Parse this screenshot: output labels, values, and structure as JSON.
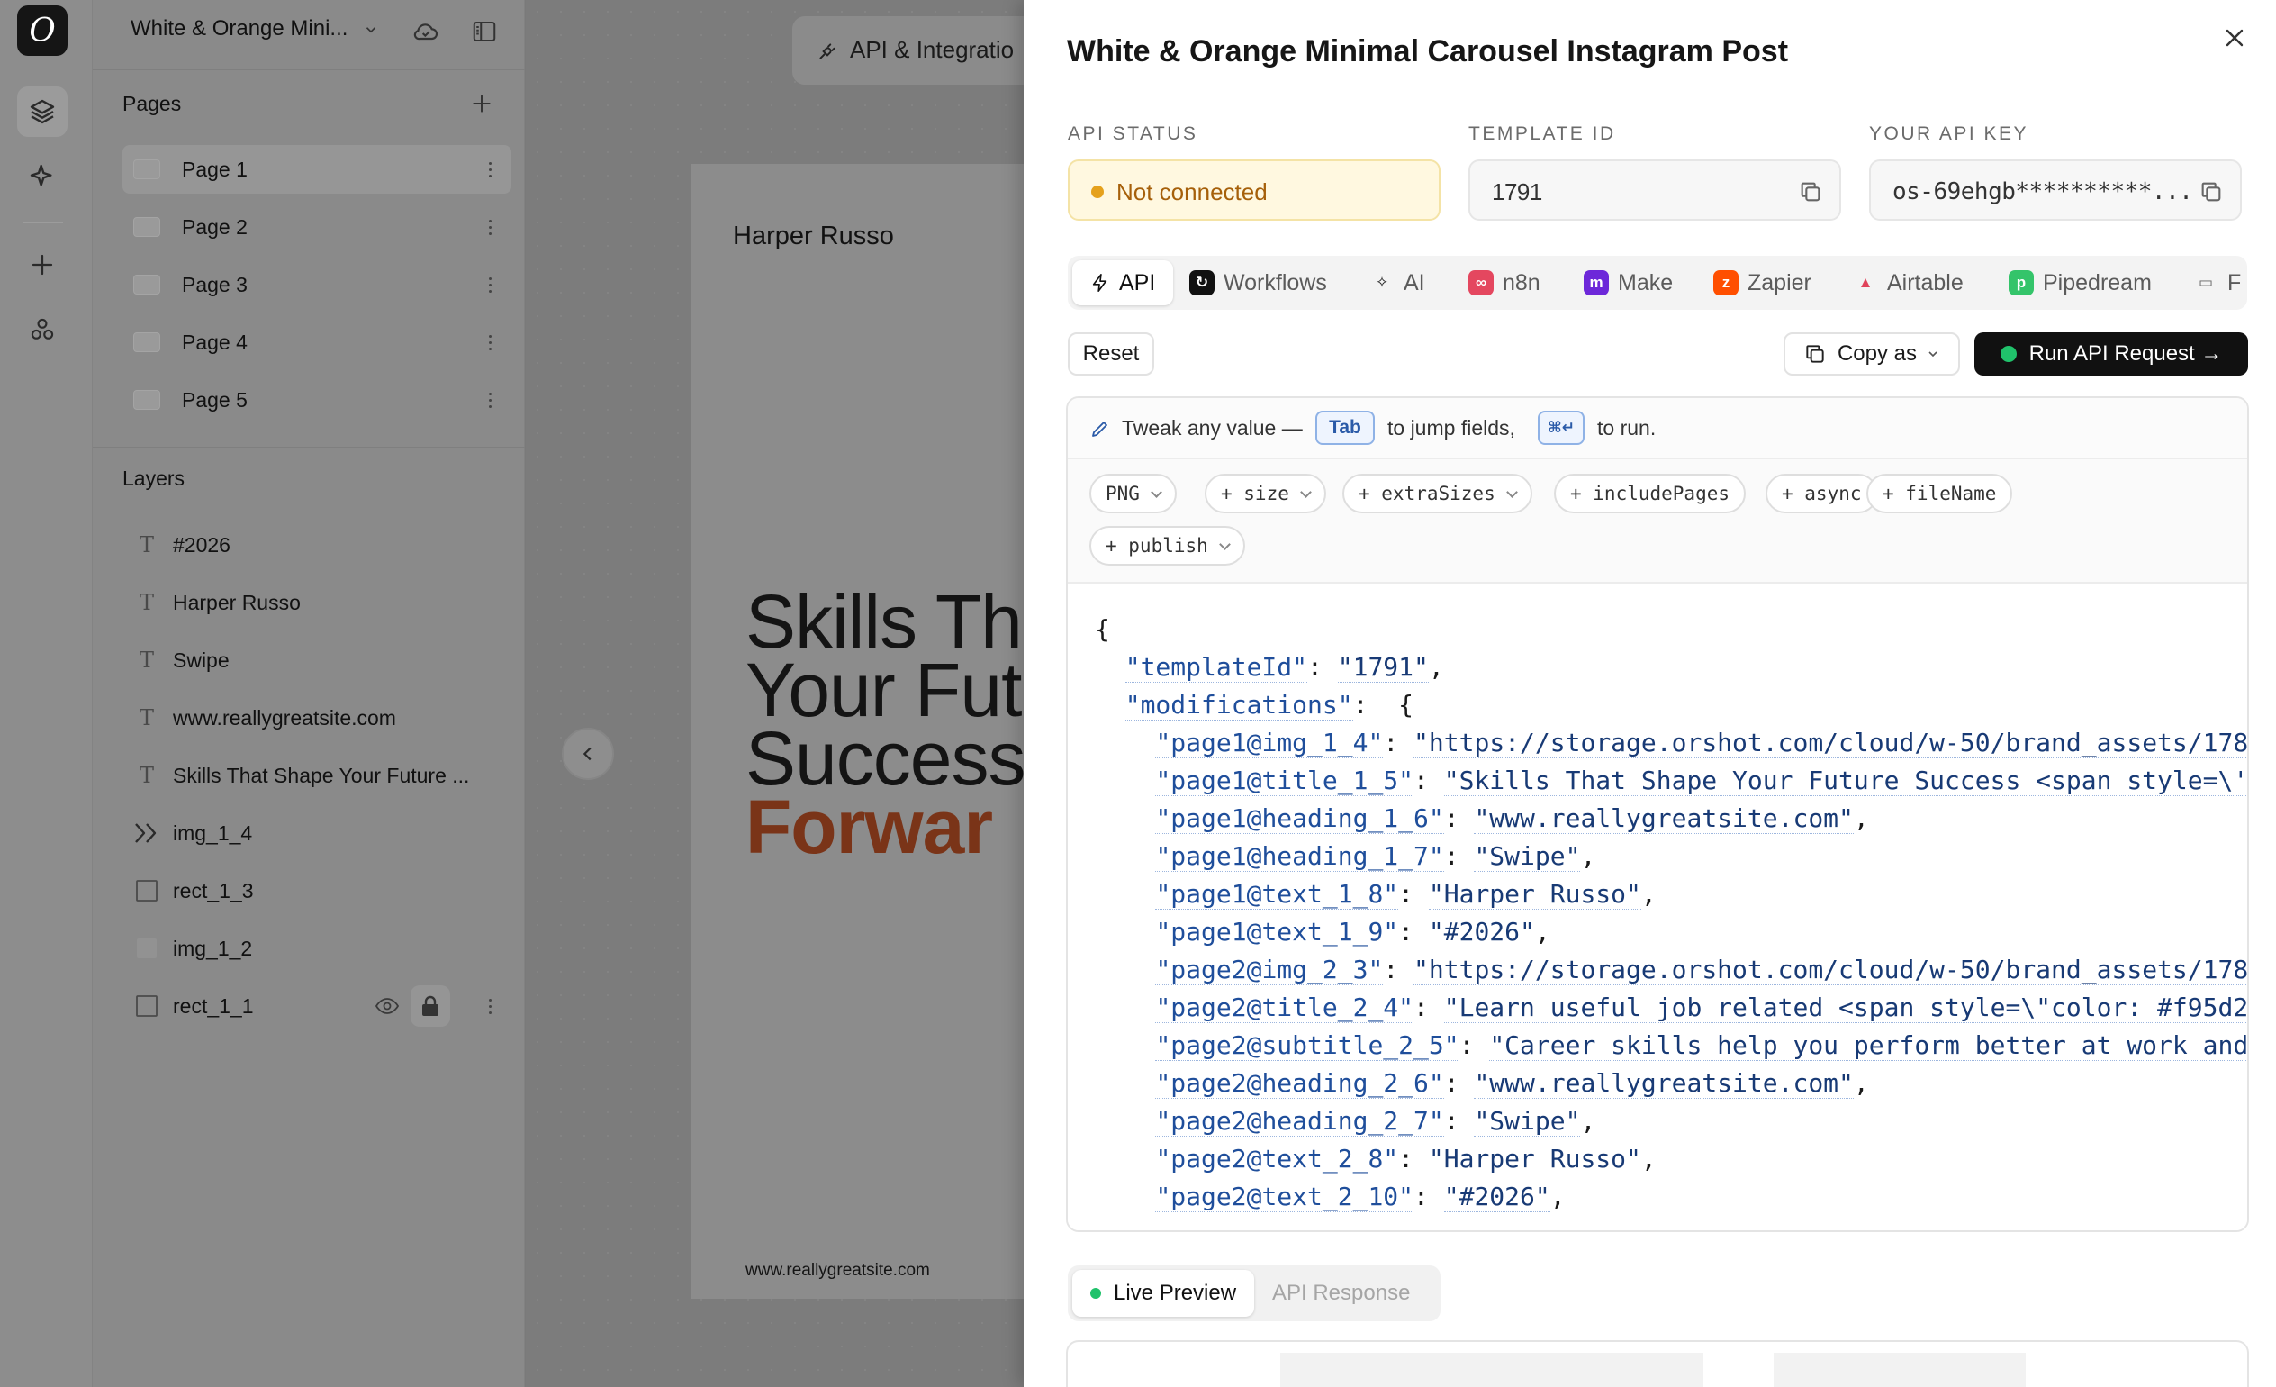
{
  "rail": {
    "logo": "O"
  },
  "panel": {
    "doc_title": "White & Orange Mini...",
    "pages_title": "Pages",
    "pages": [
      {
        "label": "Page 1"
      },
      {
        "label": "Page 2"
      },
      {
        "label": "Page 3"
      },
      {
        "label": "Page 4"
      },
      {
        "label": "Page 5"
      }
    ],
    "layers_title": "Layers",
    "layers": [
      {
        "label": "#2026",
        "icon": "text-icon"
      },
      {
        "label": "Harper Russo",
        "icon": "text-icon"
      },
      {
        "label": "Swipe",
        "icon": "text-icon"
      },
      {
        "label": "www.reallygreatsite.com",
        "icon": "text-icon"
      },
      {
        "label": "Skills That Shape Your Future ...",
        "icon": "text-icon"
      },
      {
        "label": "img_1_4",
        "icon": "image-arrows-icon"
      },
      {
        "label": "rect_1_3",
        "icon": "rect-icon"
      },
      {
        "label": "img_1_2",
        "icon": "image-icon"
      },
      {
        "label": "rect_1_1",
        "icon": "rect-icon"
      }
    ]
  },
  "canvas": {
    "tab_label": "API & Integratio",
    "author": "Harper Russo",
    "title_lines": [
      "Skills Th",
      "Your Fut",
      "Success"
    ],
    "title_accent": "Forwar",
    "site": "www.reallygreatsite.com"
  },
  "drawer": {
    "title": "White & Orange Minimal Carousel Instagram Post",
    "api_status_label": "API STATUS",
    "api_status_value": "Not connected",
    "template_id_label": "TEMPLATE ID",
    "template_id_value": "1791",
    "api_key_label": "YOUR API KEY",
    "api_key_value": "os-69ehgb**********...",
    "tabs": [
      {
        "label": "API",
        "color": "#ffffff",
        "glyph": "⚡"
      },
      {
        "label": "Workflows",
        "color": "#111111",
        "glyph": "↻"
      },
      {
        "label": "AI",
        "color": "#ffffff",
        "glyph": "✧"
      },
      {
        "label": "n8n",
        "color": "#e4475f",
        "glyph": "∞"
      },
      {
        "label": "Make",
        "color": "#6d28d9",
        "glyph": "m"
      },
      {
        "label": "Zapier",
        "color": "#ff4f00",
        "glyph": "z"
      },
      {
        "label": "Airtable",
        "color": "#f7b731",
        "glyph": "▲"
      },
      {
        "label": "Pipedream",
        "color": "#34c46a",
        "glyph": "p"
      },
      {
        "label": "F",
        "color": "#ffffff",
        "glyph": "▭"
      }
    ],
    "reset_label": "Reset",
    "copy_as_label": "Copy as",
    "run_label": "Run API Request →",
    "hint_prefix": "Tweak any value —",
    "hint_tab_key": "Tab",
    "hint_middle": "to jump fields,",
    "hint_run_key": "⌘↵",
    "hint_suffix": "to run.",
    "chips": [
      {
        "label": "PNG",
        "caret": true
      },
      {
        "label": "+ size",
        "caret": true
      },
      {
        "label": "+ extraSizes",
        "caret": true
      },
      {
        "label": "+ includePages",
        "caret": false
      },
      {
        "label": "+ async",
        "caret": false
      },
      {
        "label": "+ fileName",
        "caret": false
      },
      {
        "label": "+ publish",
        "caret": true
      }
    ],
    "code_lines": [
      {
        "indent": "",
        "key": "",
        "value": "",
        "raw": "{"
      },
      {
        "indent": "  ",
        "key": "\"templateId\"",
        "value": "\"1791\"",
        "tail": ","
      },
      {
        "indent": "  ",
        "key": "\"modifications\"",
        "value": "",
        "tail": " {"
      },
      {
        "indent": "    ",
        "key": "\"page1@img_1_4\"",
        "value": "\"https://storage.orshot.com/cloud/w-50/brand_assets/178",
        "tail": ""
      },
      {
        "indent": "    ",
        "key": "\"page1@title_1_5\"",
        "value": "\"Skills That Shape Your Future Success <span style=\\'",
        "tail": ""
      },
      {
        "indent": "    ",
        "key": "\"page1@heading_1_6\"",
        "value": "\"www.reallygreatsite.com\"",
        "tail": ","
      },
      {
        "indent": "    ",
        "key": "\"page1@heading_1_7\"",
        "value": "\"Swipe\"",
        "tail": ","
      },
      {
        "indent": "    ",
        "key": "\"page1@text_1_8\"",
        "value": "\"Harper Russo\"",
        "tail": ","
      },
      {
        "indent": "    ",
        "key": "\"page1@text_1_9\"",
        "value": "\"#2026\"",
        "tail": ","
      },
      {
        "indent": "    ",
        "key": "\"page2@img_2_3\"",
        "value": "\"https://storage.orshot.com/cloud/w-50/brand_assets/178",
        "tail": ""
      },
      {
        "indent": "    ",
        "key": "\"page2@title_2_4\"",
        "value": "\"Learn useful job related <span style=\\\"color: #f95d2",
        "tail": ""
      },
      {
        "indent": "    ",
        "key": "\"page2@subtitle_2_5\"",
        "value": "\"Career skills help you perform better at work and",
        "tail": ""
      },
      {
        "indent": "    ",
        "key": "\"page2@heading_2_6\"",
        "value": "\"www.reallygreatsite.com\"",
        "tail": ","
      },
      {
        "indent": "    ",
        "key": "\"page2@heading_2_7\"",
        "value": "\"Swipe\"",
        "tail": ","
      },
      {
        "indent": "    ",
        "key": "\"page2@text_2_8\"",
        "value": "\"Harper Russo\"",
        "tail": ","
      },
      {
        "indent": "    ",
        "key": "\"page2@text_2_10\"",
        "value": "\"#2026\"",
        "tail": ","
      }
    ],
    "live_preview_label": "Live Preview",
    "api_response_label": "API Response"
  }
}
